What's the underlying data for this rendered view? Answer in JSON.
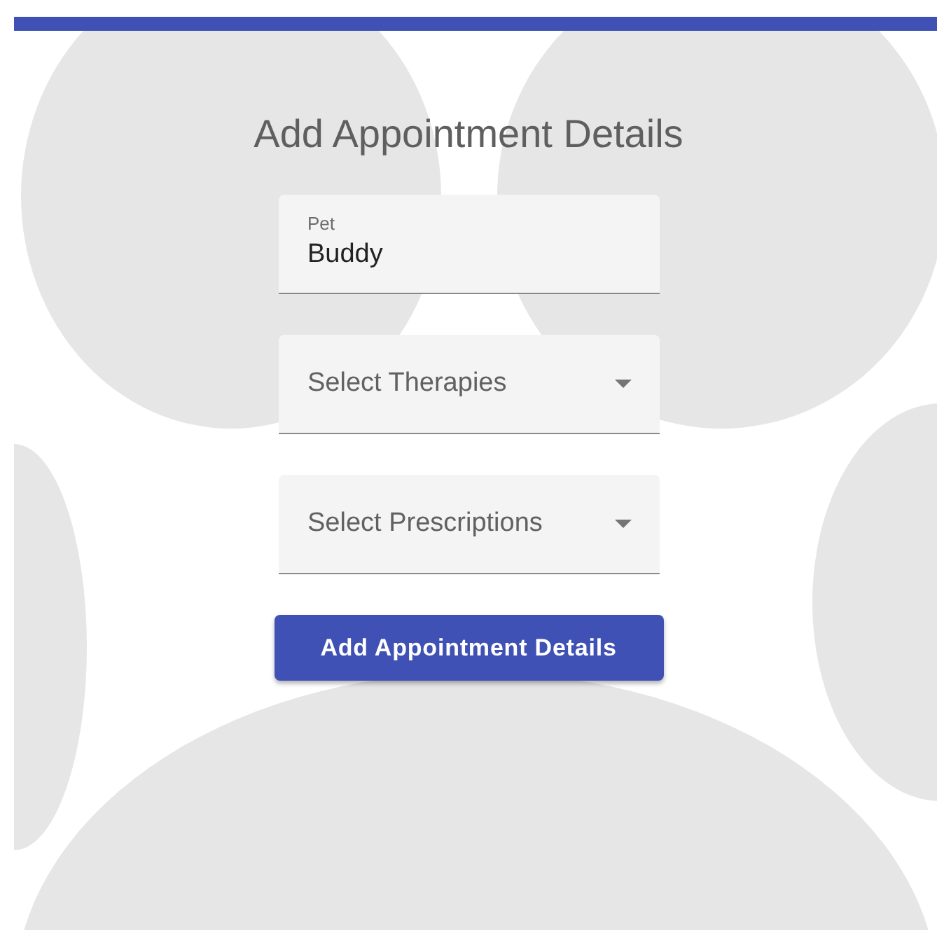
{
  "title": "Add Appointment Details",
  "fields": [
    {
      "kind": "text",
      "label": "Pet",
      "value": "Buddy"
    },
    {
      "kind": "select",
      "placeholder": "Select Therapies"
    },
    {
      "kind": "select",
      "placeholder": "Select Prescriptions"
    }
  ],
  "button": "Add Appointment Details"
}
